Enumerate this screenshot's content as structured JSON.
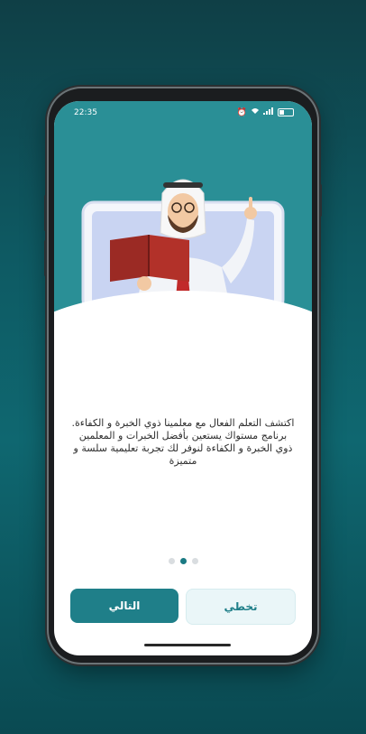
{
  "status_bar": {
    "time": "22:35",
    "battery_level": 0.35
  },
  "onboarding": {
    "headline": "اكتشف التعلم الفعال مع معلمينا ذوي الخبرة و الكفاءة.",
    "description": "برنامج مستواك يستعين بأفضل الخبرات و المعلمين ذوي الخبرة و الكفاءة لنوفر لك تجربة تعليمية سلسة و متميزة",
    "page_indicator": {
      "total": 3,
      "current": 2
    }
  },
  "buttons": {
    "next_label": "التالي",
    "skip_label": "تخطي"
  },
  "colors": {
    "primary": "#1f7f89",
    "hero_bg": "#2a8f96",
    "skip_bg": "#eaf6f8",
    "page_bg_dark": "#0f3f46"
  },
  "illustration": {
    "subject": "teacher-reading-book-from-laptop"
  }
}
